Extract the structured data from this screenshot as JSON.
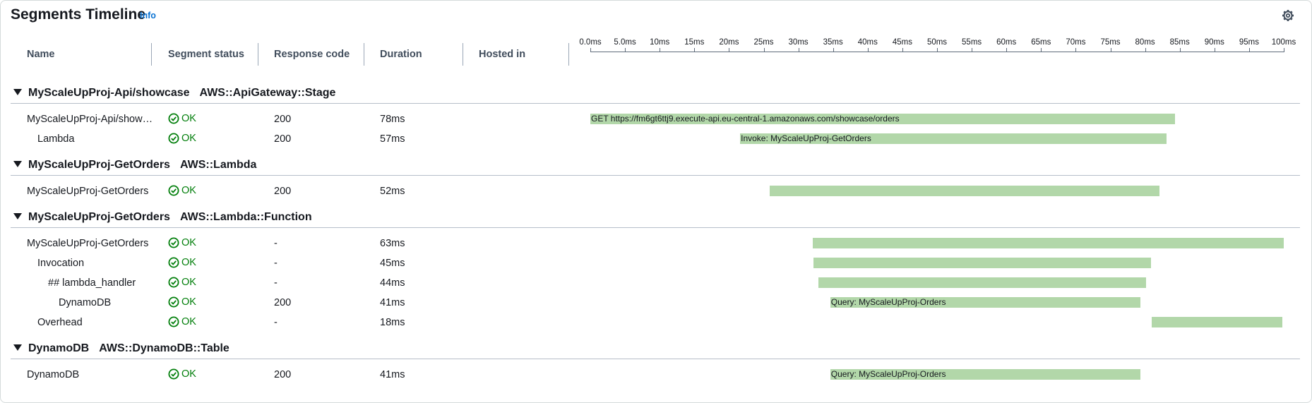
{
  "header": {
    "title": "Segments Timeline",
    "info_link": "Info",
    "settings_icon": "gear-icon"
  },
  "columns": [
    "Name",
    "Segment status",
    "Response code",
    "Duration",
    "Hosted in"
  ],
  "axis": {
    "unit": "ms",
    "ticks": [
      "0.0ms",
      "5.0ms",
      "10ms",
      "15ms",
      "20ms",
      "25ms",
      "30ms",
      "35ms",
      "40ms",
      "45ms",
      "50ms",
      "55ms",
      "60ms",
      "65ms",
      "70ms",
      "75ms",
      "80ms",
      "85ms",
      "90ms",
      "95ms",
      "100ms"
    ],
    "range_ms": [
      0,
      100
    ]
  },
  "colors": {
    "bar": "#b2d7a9",
    "ok": "#037f0c",
    "link": "#0972d3"
  },
  "groups": [
    {
      "name": "MyScaleUpProj-Api/showcase",
      "type": "AWS::ApiGateway::Stage"
    },
    {
      "name": "MyScaleUpProj-GetOrders",
      "type": "AWS::Lambda"
    },
    {
      "name": "MyScaleUpProj-GetOrders",
      "type": "AWS::Lambda::Function"
    },
    {
      "name": "DynamoDB",
      "type": "AWS::DynamoDB::Table"
    }
  ],
  "rows": [
    {
      "name": "MyScaleUpProj-Api/show…",
      "status": "OK",
      "code": "200",
      "duration": "78ms",
      "bar_label": "GET https://fm6gt6ttj9.execute-api.eu-central-1.amazonaws.com/showcase/orders",
      "start_ms": 0,
      "end_ms": 84.3
    },
    {
      "name": "Lambda",
      "status": "OK",
      "code": "200",
      "duration": "57ms",
      "bar_label": "Invoke: MyScaleUpProj-GetOrders",
      "start_ms": 21.6,
      "end_ms": 83.1
    },
    {
      "name": "MyScaleUpProj-GetOrders",
      "status": "OK",
      "code": "200",
      "duration": "52ms",
      "bar_label": "",
      "start_ms": 25.9,
      "end_ms": 82.1
    },
    {
      "name": "MyScaleUpProj-GetOrders",
      "status": "OK",
      "code": "-",
      "duration": "63ms",
      "bar_label": "",
      "start_ms": 32.1,
      "end_ms": 100.0
    },
    {
      "name": "Invocation",
      "status": "OK",
      "code": "-",
      "duration": "45ms",
      "bar_label": "",
      "start_ms": 32.2,
      "end_ms": 80.9
    },
    {
      "name": "## lambda_handler",
      "status": "OK",
      "code": "-",
      "duration": "44ms",
      "bar_label": "",
      "start_ms": 32.9,
      "end_ms": 80.1
    },
    {
      "name": "DynamoDB",
      "status": "OK",
      "code": "200",
      "duration": "41ms",
      "bar_label": "Query: MyScaleUpProj-Orders",
      "start_ms": 34.6,
      "end_ms": 79.3
    },
    {
      "name": "Overhead",
      "status": "OK",
      "code": "-",
      "duration": "18ms",
      "bar_label": "",
      "start_ms": 81.0,
      "end_ms": 99.8
    },
    {
      "name": "DynamoDB",
      "status": "OK",
      "code": "200",
      "duration": "41ms",
      "bar_label": "Query: MyScaleUpProj-Orders",
      "start_ms": 34.6,
      "end_ms": 79.3
    }
  ]
}
